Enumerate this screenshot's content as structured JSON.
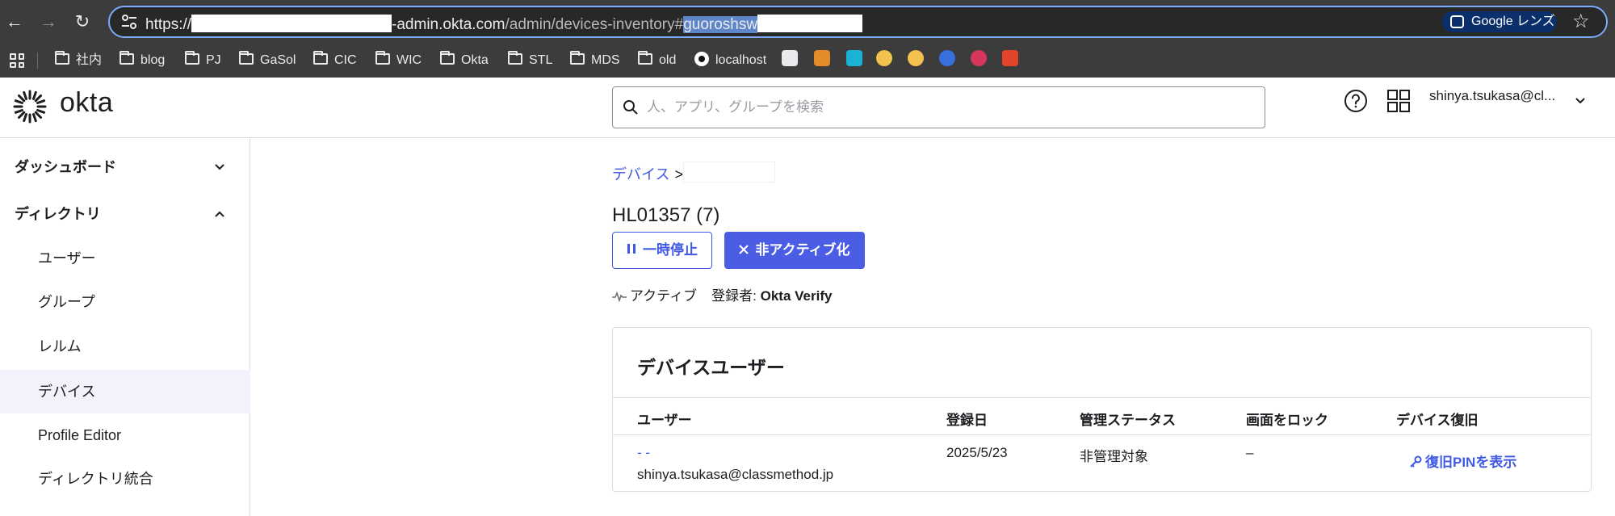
{
  "browser": {
    "url_prefix": "https://",
    "url_host_tail": "-admin.okta.com",
    "url_path": "/admin/devices-inventory#",
    "url_hash": "guoroshsw",
    "lens_label": "Google レンズ",
    "bookmarks": [
      "社内",
      "blog",
      "PJ",
      "GaSol",
      "CIC",
      "WIC",
      "Okta",
      "STL",
      "MDS",
      "old",
      "localhost"
    ]
  },
  "header": {
    "brand": "okta",
    "search_placeholder": "人、アプリ、グループを検索",
    "user_display": "shinya.tsukasa@cl..."
  },
  "sidebar": {
    "groups": [
      {
        "label": "ダッシュボード",
        "expanded": false
      },
      {
        "label": "ディレクトリ",
        "expanded": true
      }
    ],
    "items": [
      "ユーザー",
      "グループ",
      "レルム",
      "デバイス",
      "Profile Editor",
      "ディレクトリ統合"
    ],
    "active_item": "デバイス"
  },
  "main": {
    "breadcrumb_root": "デバイス",
    "breadcrumb_sep": ">",
    "title": "HL01357 (7)",
    "suspend_label": "一時停止",
    "deactivate_label": "非アクティブ化",
    "status": "アクティブ",
    "registered_by_label": "登録者:",
    "registered_by_value": "Okta Verify"
  },
  "device_users": {
    "title": "デバイスユーザー",
    "columns": [
      "ユーザー",
      "登録日",
      "管理ステータス",
      "画面をロック",
      "デバイス復旧"
    ],
    "rows": [
      {
        "user_name": "- -",
        "user_email": "shinya.tsukasa@classmethod.jp",
        "registered": "2025/5/23",
        "management": "非管理対象",
        "screen_lock": "–",
        "recovery_label": "復旧PINを表示"
      }
    ]
  },
  "colors": {
    "accent": "#3f59e4",
    "primary_button": "#4a5de4",
    "chrome": "#3c3c3c",
    "active_nav_bg": "#f1f2fb"
  }
}
